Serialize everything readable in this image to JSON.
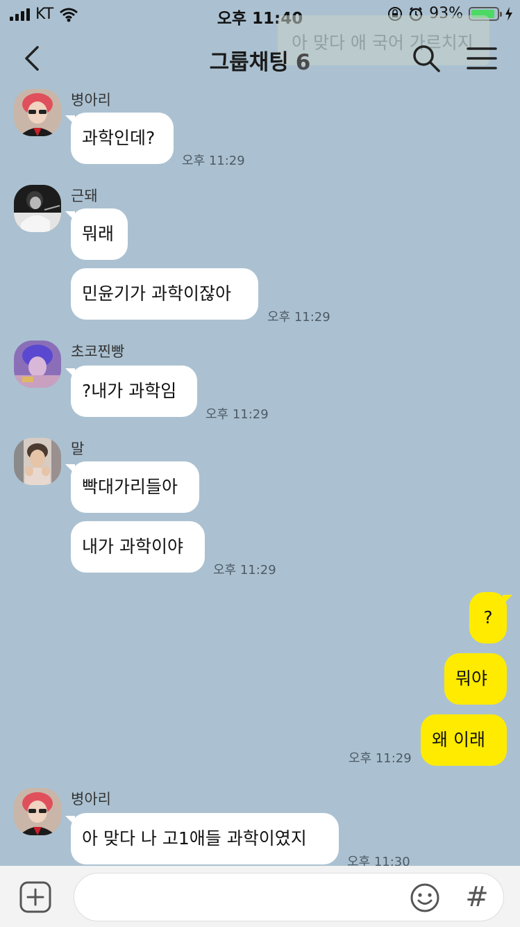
{
  "status_bar": {
    "carrier": "KT",
    "time": "오후 11:40",
    "battery_text": "93%",
    "battery_level": 0.93,
    "battery_color": "#4cd964"
  },
  "notification_preview": "아 맞다 애 국어 가르치지",
  "header": {
    "title": "그룹채팅",
    "member_count": "6",
    "back_icon": "chevron-left-icon",
    "search_icon": "search-icon",
    "menu_icon": "hamburger-menu-icon"
  },
  "theme": {
    "background": "#abc1d1",
    "my_bubble": "#ffeb00",
    "other_bubble": "#ffffff"
  },
  "messages": [
    {
      "sender": "병아리",
      "texts": [
        "과학인데?"
      ],
      "time": "오후 11:29"
    },
    {
      "sender": "근돼",
      "texts": [
        "뭐래",
        "민윤기가 과학이잖아"
      ],
      "time": "오후 11:29"
    },
    {
      "sender": "초코찐빵",
      "texts": [
        "?내가 과학임"
      ],
      "time": "오후 11:29"
    },
    {
      "sender": "말",
      "texts": [
        "빡대가리들아",
        "내가 과학이야"
      ],
      "time": "오후 11:29"
    },
    {
      "sender": "me",
      "texts": [
        "?",
        "뭐야",
        "왜 이래"
      ],
      "time": "오후 11:29"
    },
    {
      "sender": "병아리",
      "texts": [
        "아 맞다 나 고1애들 과학이였지"
      ],
      "time": "오후 11:30"
    }
  ],
  "input_bar": {
    "placeholder": "",
    "add_icon": "plus-square-icon",
    "emoji_icon": "smiley-icon",
    "hashtag_label": "#"
  }
}
